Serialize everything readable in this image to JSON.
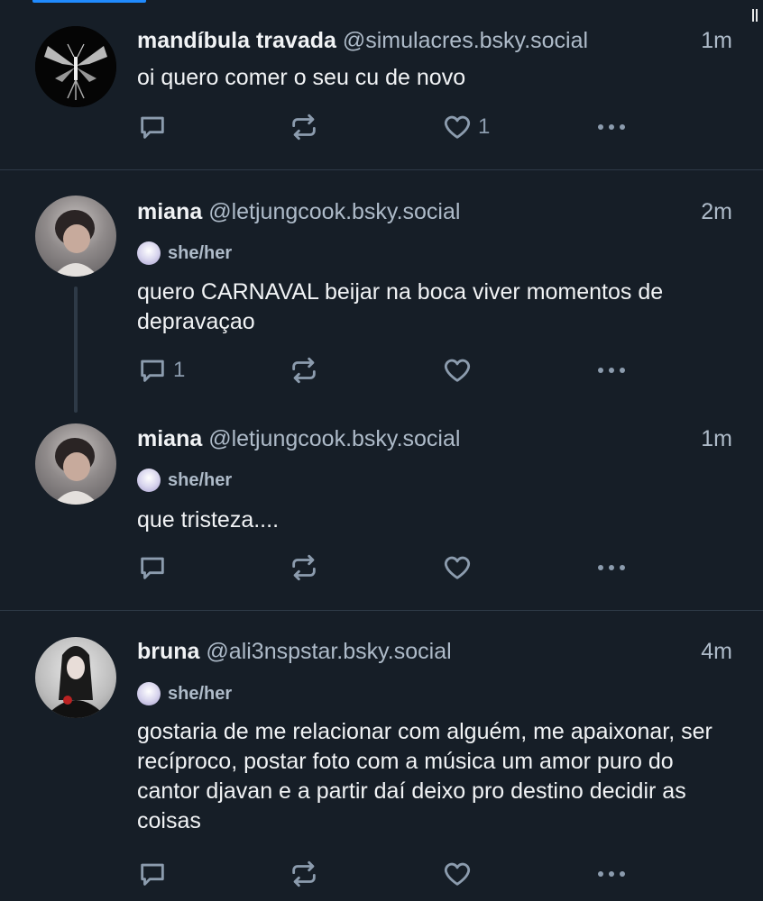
{
  "posts": [
    {
      "name": "mandíbula travada",
      "handle": "@simulacres.bsky.social",
      "time": "1m",
      "pronouns": "",
      "text": "oi quero comer o seu cu de novo",
      "reply_count": "",
      "repost_count": "",
      "like_count": "1",
      "avatar_icon": "moth-avatar"
    },
    {
      "name": "miana",
      "handle": "@letjungcook.bsky.social",
      "time": "2m",
      "pronouns": "she/her",
      "text": "quero CARNAVAL beijar na boca viver momentos de depravaçao",
      "reply_count": "1",
      "repost_count": "",
      "like_count": "",
      "avatar_icon": "user-avatar"
    },
    {
      "name": "miana",
      "handle": "@letjungcook.bsky.social",
      "time": "1m",
      "pronouns": "she/her",
      "text": "que tristeza....",
      "reply_count": "",
      "repost_count": "",
      "like_count": "",
      "avatar_icon": "user-avatar"
    },
    {
      "name": "bruna",
      "handle": "@ali3nspstar.bsky.social",
      "time": "4m",
      "pronouns": "she/her",
      "text": "gostaria de me relacionar com alguém, me apaixonar, ser recíproco, postar foto com a música um amor puro do cantor djavan e a partir daí deixo pro destino decidir as coisas",
      "reply_count": "",
      "repost_count": "",
      "like_count": "",
      "avatar_icon": "user-avatar"
    }
  ],
  "icons": {
    "reply": "reply-icon",
    "repost": "repost-icon",
    "like": "heart-icon",
    "more": "more-icon"
  },
  "colors": {
    "background": "#161e27",
    "divider": "#2e3a47",
    "handle": "#aebbc9",
    "action": "#8c9cae",
    "accent": "#208bfe"
  }
}
